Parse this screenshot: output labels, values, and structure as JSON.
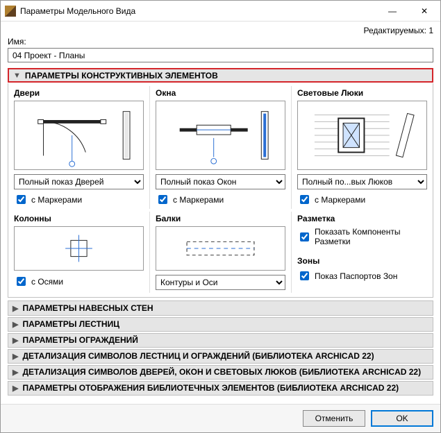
{
  "window": {
    "title": "Параметры Модельного Вида"
  },
  "edit_count": "Редактируемых: 1",
  "name_label": "Имя:",
  "name_value": "04 Проект - Планы",
  "sections": {
    "constructive": {
      "title": "ПАРАМЕТРЫ КОНСТРУКТИВНЫХ ЭЛЕМЕНТОВ",
      "doors": {
        "label": "Двери",
        "combo": "Полный показ Дверей",
        "chk": "с Маркерами"
      },
      "windows": {
        "label": "Окна",
        "combo": "Полный показ Окон",
        "chk": "с Маркерами"
      },
      "skylights": {
        "label": "Световые Люки",
        "combo": "Полный по...вых Люков",
        "chk": "с Маркерами"
      },
      "columns": {
        "label": "Колонны",
        "chk": "с Осями"
      },
      "beams": {
        "label": "Балки",
        "combo": "Контуры и Оси"
      },
      "markup": {
        "label": "Разметка",
        "chk": "Показать Компоненты Разметки"
      },
      "zones": {
        "label": "Зоны",
        "chk": "Показ Паспортов Зон"
      }
    },
    "collapsed": [
      "ПАРАМЕТРЫ НАВЕСНЫХ СТЕН",
      "ПАРАМЕТРЫ ЛЕСТНИЦ",
      "ПАРАМЕТРЫ ОГРАЖДЕНИЙ",
      "ДЕТАЛИЗАЦИЯ СИМВОЛОВ ЛЕСТНИЦ И ОГРАЖДЕНИЙ (БИБЛИОТЕКА ARCHICAD 22)",
      "ДЕТАЛИЗАЦИЯ СИМВОЛОВ ДВЕРЕЙ, ОКОН И СВЕТОВЫХ ЛЮКОВ (БИБЛИОТЕКА ARCHICAD 22)",
      "ПАРАМЕТРЫ ОТОБРАЖЕНИЯ БИБЛИОТЕЧНЫХ ЭЛЕМЕНТОВ (БИБЛИОТЕКА ARCHICAD 22)"
    ]
  },
  "buttons": {
    "cancel": "Отменить",
    "ok": "OK"
  }
}
